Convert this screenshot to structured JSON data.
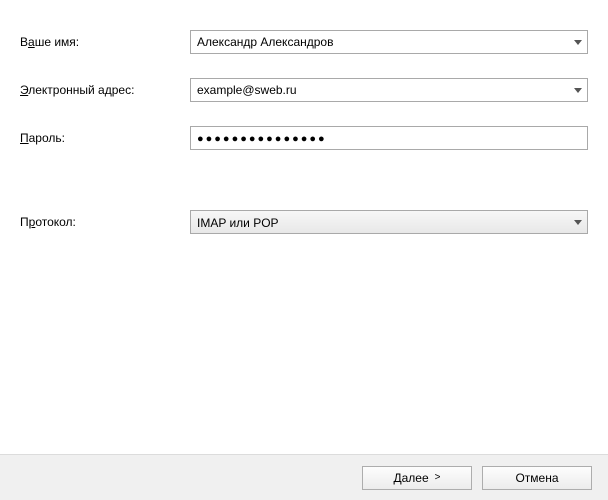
{
  "form": {
    "name": {
      "label_pre": "В",
      "label_ul": "а",
      "label_post": "ше имя:",
      "value": "Александр Александров"
    },
    "email": {
      "label_pre": "",
      "label_ul": "Э",
      "label_post": "лектронный адрес:",
      "value": "example@sweb.ru"
    },
    "password": {
      "label_pre": "",
      "label_ul": "П",
      "label_post": "ароль:",
      "masked": "●●●●●●●●●●●●●●●"
    },
    "protocol": {
      "label_pre": "П",
      "label_ul": "р",
      "label_post": "отокол:",
      "value": "IMAP или POP"
    }
  },
  "buttons": {
    "next": "Далее",
    "next_chevron": ">",
    "cancel": "Отмена"
  }
}
